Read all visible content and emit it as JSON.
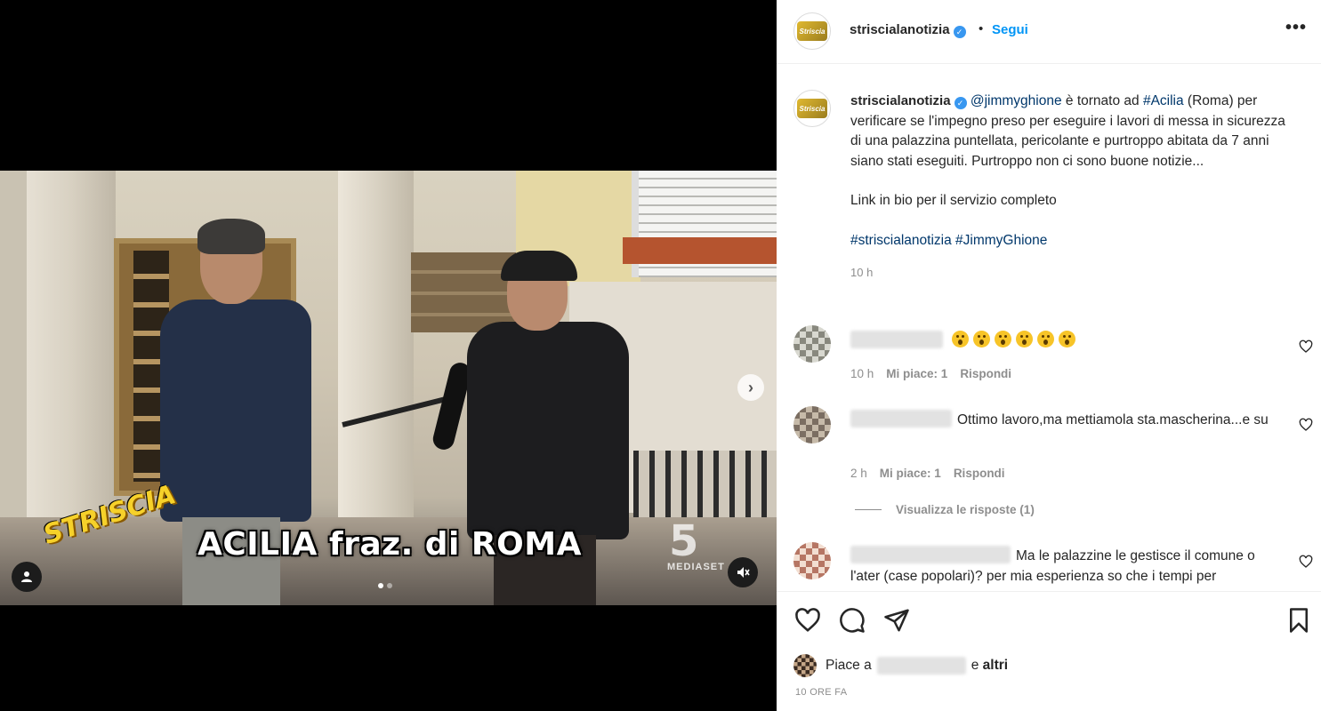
{
  "post": {
    "account": "striscialanotizia",
    "avatar_text": "Striscia",
    "follow_label": "Segui",
    "separator": "•",
    "more_label": "•••"
  },
  "media": {
    "caption_overlay": "ACILIA fraz. di ROMA",
    "logo_text": "STRISCIA",
    "channel_number": "5",
    "channel_name": "MEDIASET",
    "carousel_total": 2,
    "carousel_active": 1,
    "next_icon": "chevron-right-icon",
    "tag_icon": "user-icon",
    "mute_icon": "muted-speaker-icon"
  },
  "caption": {
    "author": "striscialanotizia",
    "mention": "@jimmyghione",
    "text_1": " è tornato ad ",
    "hashtag_place": "#Acilia",
    "text_2": " (Roma) per verificare se l'impegno preso per eseguire i lavori di messa in sicurezza di una palazzina puntellata, pericolante e purtroppo abitata da 7 anni siano stati eseguiti. Purtroppo non ci sono buone notizie...",
    "link_line": "Link in bio per il servizio completo",
    "hashtag_1": "#striscialanotizia",
    "hashtag_2": "#JimmyGhione",
    "time": "10 h"
  },
  "comments": [
    {
      "emoji_count": 6,
      "time": "10 h",
      "likes": "Mi piace: 1",
      "reply": "Rispondi"
    },
    {
      "text": "Ottimo lavoro,ma mettiamola sta.mascherina...e su",
      "time": "2 h",
      "likes": "Mi piace: 1",
      "reply": "Rispondi",
      "view_replies": "Visualizza le risposte (1)"
    },
    {
      "text": "Ma le palazzine le gestisce il comune o l'ater (case popolari)? per mia esperienza so che i tempi per"
    }
  ],
  "actions": {
    "like_icon": "heart-icon",
    "comment_icon": "comment-icon",
    "share_icon": "send-icon",
    "save_icon": "bookmark-icon",
    "liked_by_prefix": "Piace a",
    "liked_by_suffix": "e",
    "liked_by_others": "altri",
    "post_time": "10 ORE FA"
  },
  "colors": {
    "link_blue": "#0095f6",
    "hashtag_blue": "#00376b",
    "muted": "#8e8e8e",
    "verified": "#3897f0"
  }
}
